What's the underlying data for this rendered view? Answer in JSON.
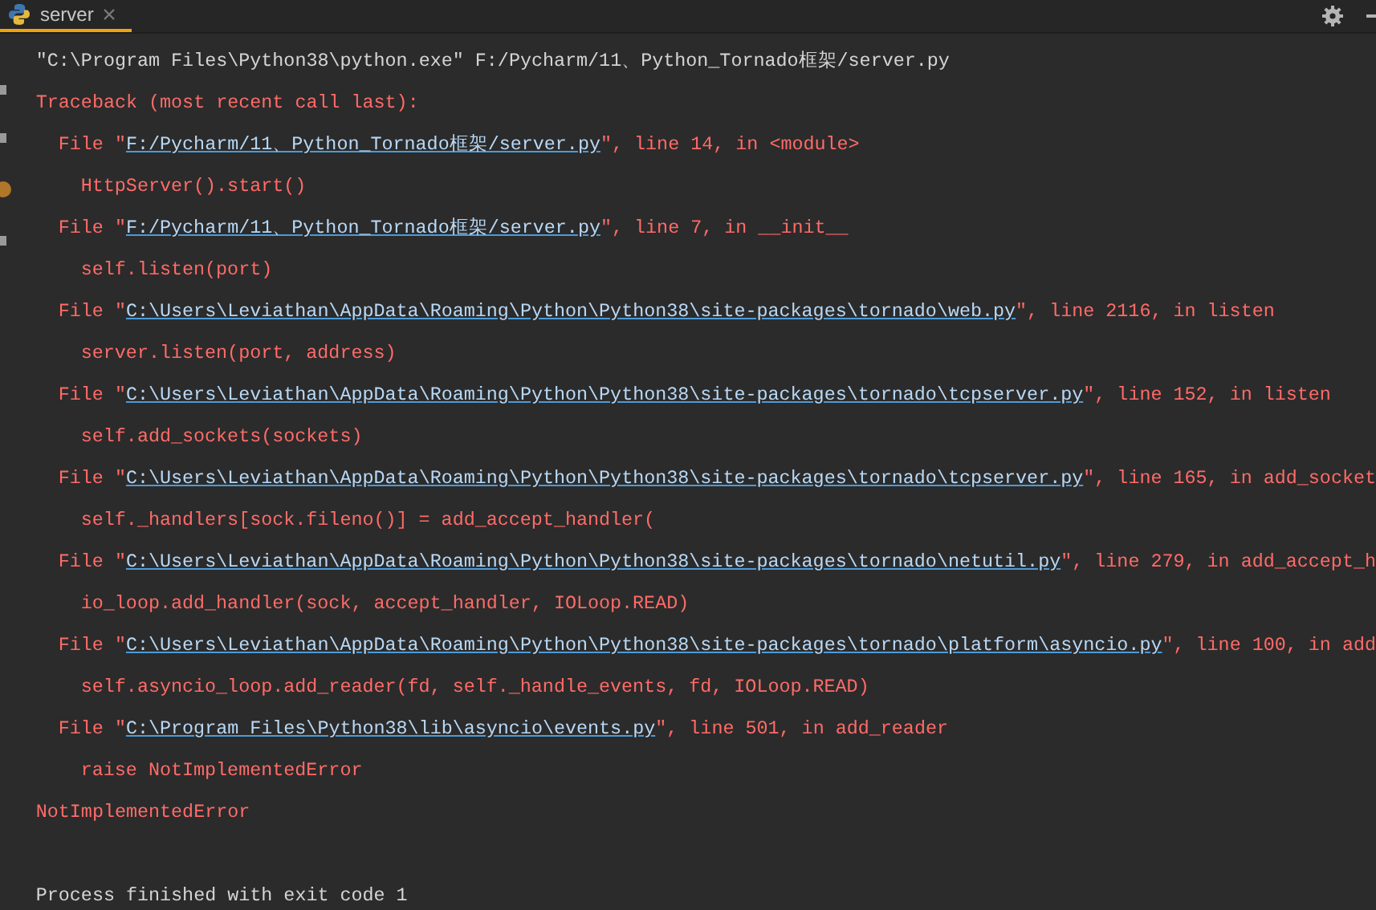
{
  "tab": {
    "label": "server",
    "selected": true
  },
  "console": [
    {
      "kind": "command",
      "text": "\"C:\\Program Files\\Python38\\python.exe\" F:/Pycharm/11、Python_Tornado框架/server.py"
    },
    {
      "kind": "error",
      "text": "Traceback (most recent call last):"
    },
    {
      "kind": "frame",
      "prefix": "File \"",
      "path": "F:/Pycharm/11、Python_Tornado框架/server.py",
      "suffix": "\", line 14, in <module>"
    },
    {
      "kind": "code",
      "text": "HttpServer().start()"
    },
    {
      "kind": "frame",
      "prefix": "File \"",
      "path": "F:/Pycharm/11、Python_Tornado框架/server.py",
      "suffix": "\", line 7, in __init__"
    },
    {
      "kind": "code",
      "text": "self.listen(port)"
    },
    {
      "kind": "frame",
      "prefix": "File \"",
      "path": "C:\\Users\\Leviathan\\AppData\\Roaming\\Python\\Python38\\site-packages\\tornado\\web.py",
      "suffix": "\", line 2116, in listen"
    },
    {
      "kind": "code",
      "text": "server.listen(port, address)"
    },
    {
      "kind": "frame",
      "prefix": "File \"",
      "path": "C:\\Users\\Leviathan\\AppData\\Roaming\\Python\\Python38\\site-packages\\tornado\\tcpserver.py",
      "suffix": "\", line 152, in listen"
    },
    {
      "kind": "code",
      "text": "self.add_sockets(sockets)"
    },
    {
      "kind": "frame",
      "prefix": "File \"",
      "path": "C:\\Users\\Leviathan\\AppData\\Roaming\\Python\\Python38\\site-packages\\tornado\\tcpserver.py",
      "suffix": "\", line 165, in add_socket"
    },
    {
      "kind": "code",
      "text": "self._handlers[sock.fileno()] = add_accept_handler("
    },
    {
      "kind": "frame",
      "prefix": "File \"",
      "path": "C:\\Users\\Leviathan\\AppData\\Roaming\\Python\\Python38\\site-packages\\tornado\\netutil.py",
      "suffix": "\", line 279, in add_accept_h"
    },
    {
      "kind": "code",
      "text": "io_loop.add_handler(sock, accept_handler, IOLoop.READ)"
    },
    {
      "kind": "frame",
      "prefix": "File \"",
      "path": "C:\\Users\\Leviathan\\AppData\\Roaming\\Python\\Python38\\site-packages\\tornado\\platform\\asyncio.py",
      "suffix": "\", line 100, in add"
    },
    {
      "kind": "code",
      "text": "self.asyncio_loop.add_reader(fd, self._handle_events, fd, IOLoop.READ)"
    },
    {
      "kind": "frame",
      "prefix": "File \"",
      "path": "C:\\Program Files\\Python38\\lib\\asyncio\\events.py",
      "suffix": "\", line 501, in add_reader"
    },
    {
      "kind": "code",
      "text": "raise NotImplementedError"
    },
    {
      "kind": "error",
      "text": "NotImplementedError"
    },
    {
      "kind": "exit",
      "text": "Process finished with exit code 1"
    }
  ]
}
